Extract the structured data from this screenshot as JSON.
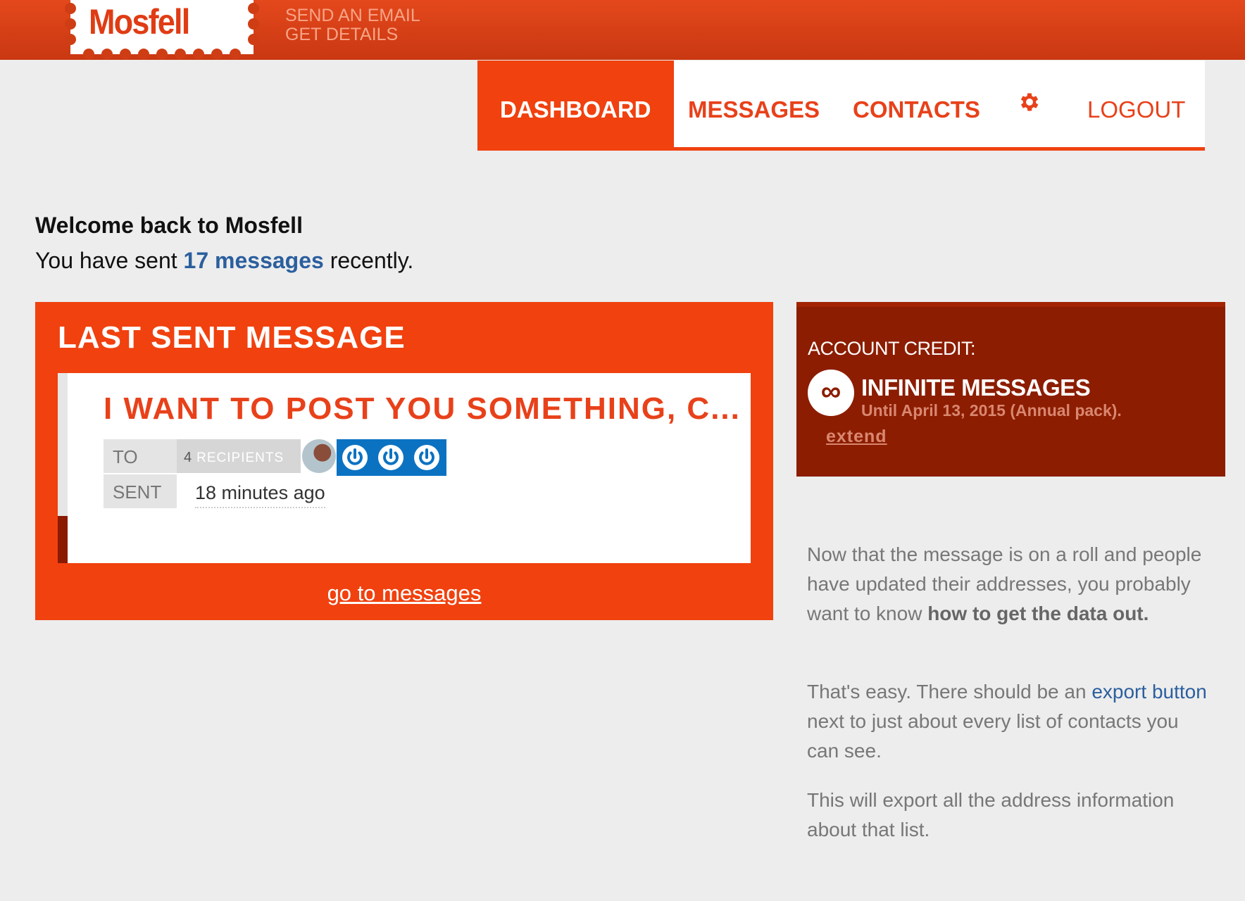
{
  "brand": {
    "logo_text": "Mosfell"
  },
  "top_links": [
    "SEND AN EMAIL",
    "GET DETAILS"
  ],
  "nav": {
    "dashboard": "DASHBOARD",
    "messages": "MESSAGES",
    "contacts": "CONTACTS",
    "settings_icon": "gear-icon",
    "logout": "LOGOUT"
  },
  "welcome": {
    "title": "Welcome back to Mosfell",
    "prefix": "You have sent",
    "count": "17 messages",
    "suffix": "recently."
  },
  "last_sent": {
    "heading": "LAST SENT MESSAGE",
    "subject": "I WANT TO POST YOU SOMETHING, C...",
    "to_label": "TO",
    "recipient_count": "4",
    "recipient_label": "RECIPIENTS",
    "sent_label": "SENT",
    "sent_time": "18 minutes ago",
    "go_link": "go to messages"
  },
  "account": {
    "label": "ACCOUNT CREDIT:",
    "badge": "∞",
    "value": "INFINITE MESSAGES",
    "until": "Until April 13, 2015 (Annual pack).",
    "extend": "extend"
  },
  "help": {
    "p1_text": "Now that the message is on a roll and people have updated their addresses, you probably want to know",
    "p1_strong": "how to get the data out.",
    "p2_pre": "That's easy. There should be an",
    "p2_link": "export button",
    "p2_post": "next to just about every list of contacts you can see.",
    "p3": "This will export all the address information about that list."
  },
  "colors": {
    "brand_orange": "#f0410f",
    "dark_red": "#8c1d00",
    "link_blue": "#2b5f9e",
    "power_blue": "#0b72c2"
  }
}
